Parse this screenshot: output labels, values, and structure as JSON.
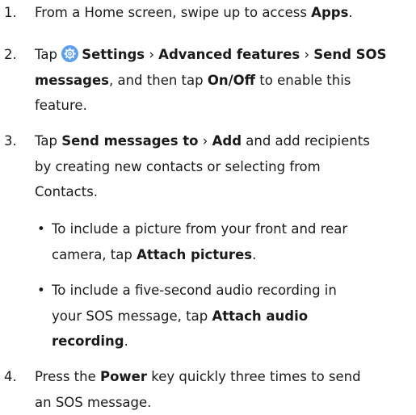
{
  "steps": [
    {
      "number": "1.",
      "lines": [
        [
          {
            "t": "From a Home screen, swipe up to access "
          },
          {
            "b": "Apps"
          },
          {
            "t": "."
          }
        ]
      ]
    },
    {
      "number": "2.",
      "lines": [
        [
          {
            "t": "Tap "
          },
          {
            "icon": "settings-gear-icon"
          },
          {
            "b": "Settings"
          },
          {
            "t": " › "
          },
          {
            "b": "Advanced features"
          },
          {
            "t": " › "
          },
          {
            "b": "Send SOS"
          }
        ],
        [
          {
            "b": "messages"
          },
          {
            "t": ", and then tap "
          },
          {
            "b": "On/Off"
          },
          {
            "t": " to enable this"
          }
        ],
        [
          {
            "t": "feature."
          }
        ]
      ]
    },
    {
      "number": "3.",
      "lines": [
        [
          {
            "t": "Tap "
          },
          {
            "b": "Send messages to"
          },
          {
            "t": " › "
          },
          {
            "b": "Add"
          },
          {
            "t": " and add recipients"
          }
        ],
        [
          {
            "t": "by creating new contacts or selecting from"
          }
        ],
        [
          {
            "t": "Contacts."
          }
        ]
      ]
    },
    {
      "number": "•",
      "bullet": true,
      "lines": [
        [
          {
            "t": "To include a picture from your front and rear"
          }
        ],
        [
          {
            "t": "camera, tap "
          },
          {
            "b": "Attach pictures"
          },
          {
            "t": "."
          }
        ]
      ]
    },
    {
      "number": "•",
      "bullet": true,
      "lines": [
        [
          {
            "t": "To include a five-second audio recording in"
          }
        ],
        [
          {
            "t": "your SOS message, tap "
          },
          {
            "b": "Attach audio"
          }
        ],
        [
          {
            "b": "recording"
          },
          {
            "t": "."
          }
        ]
      ]
    },
    {
      "number": "4.",
      "lines": [
        [
          {
            "t": "Press the "
          },
          {
            "b": "Power"
          },
          {
            "t": " key quickly three times to send"
          }
        ],
        [
          {
            "t": "an SOS message."
          }
        ]
      ]
    }
  ],
  "colors": {
    "text": "#1a1a1a",
    "settings_icon_bg": "#5aa0f0",
    "settings_icon_fg": "#ffffff"
  }
}
